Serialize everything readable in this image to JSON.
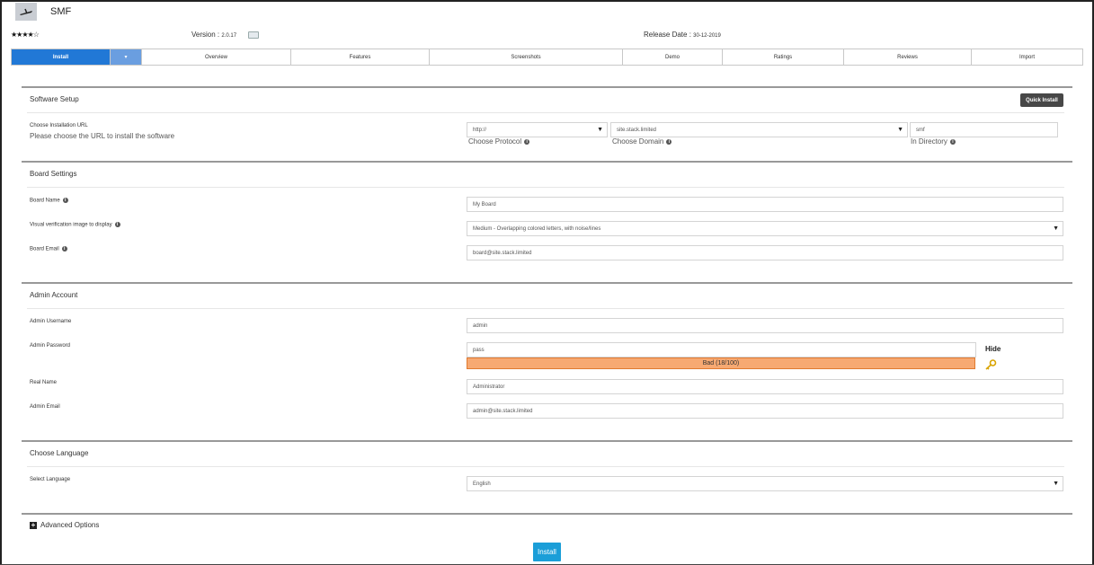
{
  "header": {
    "app_name": "SMF",
    "rating_stars": "★★★★☆",
    "version_label": "Version :",
    "version_value": "2.0.17",
    "release_label": "Release Date :",
    "release_value": "30-12-2019"
  },
  "tabs": [
    {
      "label": "Install",
      "active": true
    },
    {
      "label": "▾",
      "dropdown": true
    },
    {
      "label": "Overview"
    },
    {
      "label": "Features"
    },
    {
      "label": "Screenshots"
    },
    {
      "label": "Demo"
    },
    {
      "label": "Ratings"
    },
    {
      "label": "Reviews"
    },
    {
      "label": "Import"
    }
  ],
  "software_setup": {
    "title": "Software Setup",
    "quick_install": "Quick Install",
    "url_label": "Choose Installation URL",
    "url_help": "Please choose the URL to install the software",
    "protocol_value": "http://",
    "protocol_label": "Choose Protocol",
    "domain_value": "site.stack.limited",
    "domain_label": "Choose Domain",
    "directory_value": "smf",
    "directory_label": "In Directory"
  },
  "board_settings": {
    "title": "Board Settings",
    "board_name_label": "Board Name",
    "board_name_value": "My Board",
    "verification_label": "Visual verification image to display",
    "verification_value": "Medium - Overlapping colored letters, with noise/lines",
    "board_email_label": "Board Email",
    "board_email_value": "board@site.stack.limited"
  },
  "admin_account": {
    "title": "Admin Account",
    "username_label": "Admin Username",
    "username_value": "admin",
    "password_label": "Admin Password",
    "password_value": "pass",
    "hide_label": "Hide",
    "strength_text": "Bad (18/100)",
    "strength_color": "#f7a972",
    "real_name_label": "Real Name",
    "real_name_value": "Administrator",
    "email_label": "Admin Email",
    "email_value": "admin@site.stack.limited"
  },
  "language": {
    "title": "Choose Language",
    "select_label": "Select Language",
    "select_value": "English"
  },
  "footer": {
    "advanced_label": "Advanced Options",
    "install_button": "Install",
    "install_color": "#1b9ed8"
  }
}
